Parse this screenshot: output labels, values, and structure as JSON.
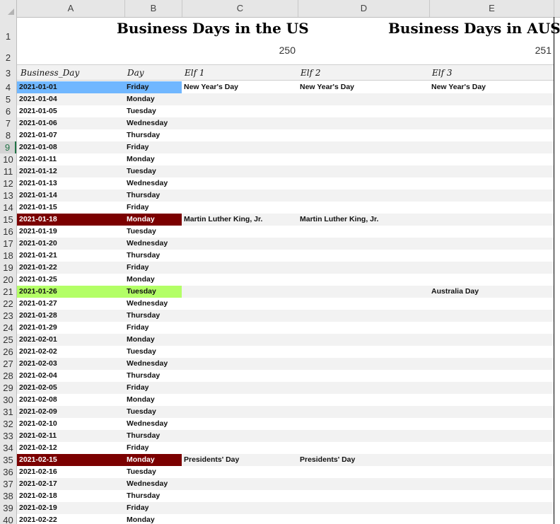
{
  "columns": [
    "A",
    "B",
    "C",
    "D",
    "E"
  ],
  "titles": {
    "us": "Business Days in the US",
    "aus": "Business Days in AUS",
    "us_count": "250",
    "aus_count": "251"
  },
  "header": {
    "business_day": "Business_Day",
    "day": "Day",
    "elf1": "Elf 1",
    "elf2": "Elf 2",
    "elf3": "Elf 3"
  },
  "rows": [
    {
      "num": "4",
      "date": "2021-01-01",
      "day": "Friday",
      "c": "New Year's Day",
      "d": "New Year's Day",
      "e": "New Year's Day",
      "hl": "#70b7ff"
    },
    {
      "num": "5",
      "date": "2021-01-04",
      "day": "Monday",
      "c": "",
      "d": "",
      "e": "",
      "hl": ""
    },
    {
      "num": "6",
      "date": "2021-01-05",
      "day": "Tuesday",
      "c": "",
      "d": "",
      "e": "",
      "hl": ""
    },
    {
      "num": "7",
      "date": "2021-01-06",
      "day": "Wednesday",
      "c": "",
      "d": "",
      "e": "",
      "hl": ""
    },
    {
      "num": "8",
      "date": "2021-01-07",
      "day": "Thursday",
      "c": "",
      "d": "",
      "e": "",
      "hl": ""
    },
    {
      "num": "9",
      "date": "2021-01-08",
      "day": "Friday",
      "c": "",
      "d": "",
      "e": "",
      "hl": ""
    },
    {
      "num": "10",
      "date": "2021-01-11",
      "day": "Monday",
      "c": "",
      "d": "",
      "e": "",
      "hl": ""
    },
    {
      "num": "11",
      "date": "2021-01-12",
      "day": "Tuesday",
      "c": "",
      "d": "",
      "e": "",
      "hl": ""
    },
    {
      "num": "12",
      "date": "2021-01-13",
      "day": "Wednesday",
      "c": "",
      "d": "",
      "e": "",
      "hl": ""
    },
    {
      "num": "13",
      "date": "2021-01-14",
      "day": "Thursday",
      "c": "",
      "d": "",
      "e": "",
      "hl": ""
    },
    {
      "num": "14",
      "date": "2021-01-15",
      "day": "Friday",
      "c": "",
      "d": "",
      "e": "",
      "hl": ""
    },
    {
      "num": "15",
      "date": "2021-01-18",
      "day": "Monday",
      "c": "Martin Luther King, Jr.",
      "d": "Martin Luther King, Jr.",
      "e": "",
      "hl": "#7b0000"
    },
    {
      "num": "16",
      "date": "2021-01-19",
      "day": "Tuesday",
      "c": "",
      "d": "",
      "e": "",
      "hl": ""
    },
    {
      "num": "17",
      "date": "2021-01-20",
      "day": "Wednesday",
      "c": "",
      "d": "",
      "e": "",
      "hl": ""
    },
    {
      "num": "18",
      "date": "2021-01-21",
      "day": "Thursday",
      "c": "",
      "d": "",
      "e": "",
      "hl": ""
    },
    {
      "num": "19",
      "date": "2021-01-22",
      "day": "Friday",
      "c": "",
      "d": "",
      "e": "",
      "hl": ""
    },
    {
      "num": "20",
      "date": "2021-01-25",
      "day": "Monday",
      "c": "",
      "d": "",
      "e": "",
      "hl": ""
    },
    {
      "num": "21",
      "date": "2021-01-26",
      "day": "Tuesday",
      "c": "",
      "d": "",
      "e": "Australia Day",
      "hl": "#b3ff66"
    },
    {
      "num": "22",
      "date": "2021-01-27",
      "day": "Wednesday",
      "c": "",
      "d": "",
      "e": "",
      "hl": ""
    },
    {
      "num": "23",
      "date": "2021-01-28",
      "day": "Thursday",
      "c": "",
      "d": "",
      "e": "",
      "hl": ""
    },
    {
      "num": "24",
      "date": "2021-01-29",
      "day": "Friday",
      "c": "",
      "d": "",
      "e": "",
      "hl": ""
    },
    {
      "num": "25",
      "date": "2021-02-01",
      "day": "Monday",
      "c": "",
      "d": "",
      "e": "",
      "hl": ""
    },
    {
      "num": "26",
      "date": "2021-02-02",
      "day": "Tuesday",
      "c": "",
      "d": "",
      "e": "",
      "hl": ""
    },
    {
      "num": "27",
      "date": "2021-02-03",
      "day": "Wednesday",
      "c": "",
      "d": "",
      "e": "",
      "hl": ""
    },
    {
      "num": "28",
      "date": "2021-02-04",
      "day": "Thursday",
      "c": "",
      "d": "",
      "e": "",
      "hl": ""
    },
    {
      "num": "29",
      "date": "2021-02-05",
      "day": "Friday",
      "c": "",
      "d": "",
      "e": "",
      "hl": ""
    },
    {
      "num": "30",
      "date": "2021-02-08",
      "day": "Monday",
      "c": "",
      "d": "",
      "e": "",
      "hl": ""
    },
    {
      "num": "31",
      "date": "2021-02-09",
      "day": "Tuesday",
      "c": "",
      "d": "",
      "e": "",
      "hl": ""
    },
    {
      "num": "32",
      "date": "2021-02-10",
      "day": "Wednesday",
      "c": "",
      "d": "",
      "e": "",
      "hl": ""
    },
    {
      "num": "33",
      "date": "2021-02-11",
      "day": "Thursday",
      "c": "",
      "d": "",
      "e": "",
      "hl": ""
    },
    {
      "num": "34",
      "date": "2021-02-12",
      "day": "Friday",
      "c": "",
      "d": "",
      "e": "",
      "hl": ""
    },
    {
      "num": "35",
      "date": "2021-02-15",
      "day": "Monday",
      "c": "Presidents' Day",
      "d": "Presidents' Day",
      "e": "",
      "hl": "#7b0000"
    },
    {
      "num": "36",
      "date": "2021-02-16",
      "day": "Tuesday",
      "c": "",
      "d": "",
      "e": "",
      "hl": ""
    },
    {
      "num": "37",
      "date": "2021-02-17",
      "day": "Wednesday",
      "c": "",
      "d": "",
      "e": "",
      "hl": ""
    },
    {
      "num": "38",
      "date": "2021-02-18",
      "day": "Thursday",
      "c": "",
      "d": "",
      "e": "",
      "hl": ""
    },
    {
      "num": "39",
      "date": "2021-02-19",
      "day": "Friday",
      "c": "",
      "d": "",
      "e": "",
      "hl": ""
    },
    {
      "num": "40",
      "date": "2021-02-22",
      "day": "Monday",
      "c": "",
      "d": "",
      "e": "",
      "hl": ""
    }
  ],
  "selected_row": "9",
  "colors": {
    "new_year_fill": "#70b7ff",
    "us_holiday_fill": "#7b0000",
    "aus_holiday_fill": "#b3ff66",
    "stripe": "#f2f2f2",
    "selection_accent": "#217346"
  }
}
